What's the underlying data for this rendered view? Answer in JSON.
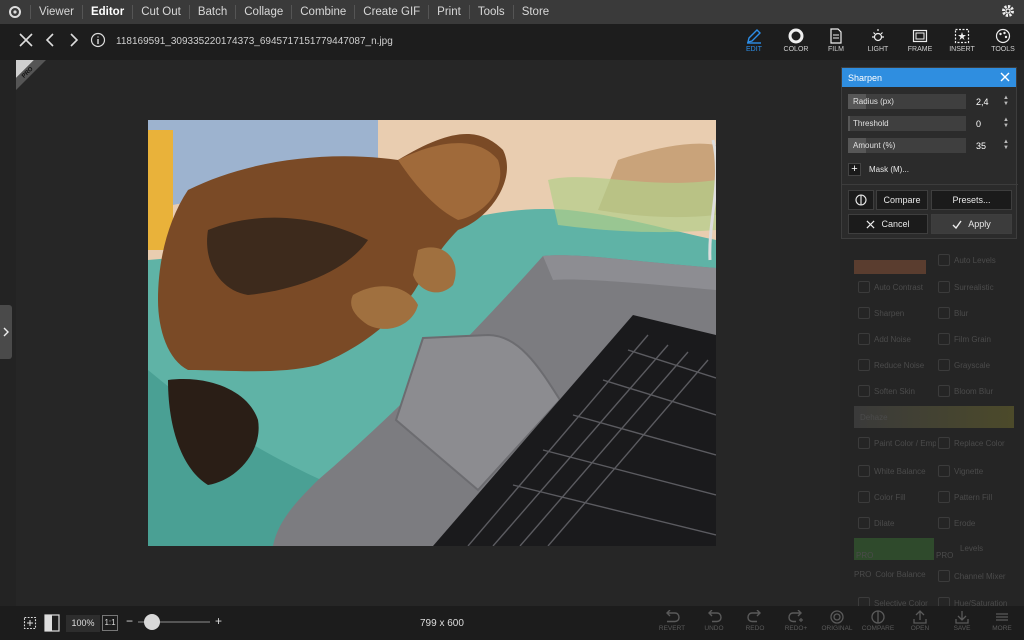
{
  "topnav": {
    "items": [
      {
        "label": "Viewer"
      },
      {
        "label": "Editor"
      },
      {
        "label": "Cut Out"
      },
      {
        "label": "Batch"
      },
      {
        "label": "Collage"
      },
      {
        "label": "Combine"
      },
      {
        "label": "Create GIF"
      },
      {
        "label": "Print"
      },
      {
        "label": "Tools"
      },
      {
        "label": "Store"
      }
    ],
    "active": "Editor"
  },
  "toolbar": {
    "filename": "118169591_309335220174373_6945717151779447087_n.jpg",
    "tools": [
      {
        "label": "EDIT",
        "icon": "edit-icon"
      },
      {
        "label": "COLOR",
        "icon": "color-icon"
      },
      {
        "label": "FILM",
        "icon": "film-icon"
      },
      {
        "label": "LIGHT",
        "icon": "light-icon"
      },
      {
        "label": "FRAME",
        "icon": "frame-icon"
      },
      {
        "label": "INSERT",
        "icon": "insert-icon"
      },
      {
        "label": "TOOLS",
        "icon": "tools-icon"
      }
    ],
    "accent": "#2c8ee8"
  },
  "canvas": {
    "pro_badge": "PRO"
  },
  "sharpen_dialog": {
    "title": "Sharpen",
    "sliders": [
      {
        "label": "Radius (px)",
        "value": "2,4",
        "fill": 0.15
      },
      {
        "label": "Threshold",
        "value": "0",
        "fill": 0.02
      },
      {
        "label": "Amount (%)",
        "value": "35",
        "fill": 0.15
      }
    ],
    "mask_label": "Mask (M)...",
    "compare_label": "Compare",
    "presets_label": "Presets...",
    "cancel_label": "Cancel",
    "apply_label": "Apply",
    "header_color": "#2f8ee0"
  },
  "right_panel": {
    "items": [
      {
        "label": "Auto Levels"
      },
      {
        "label": "Auto Contrast"
      },
      {
        "label": "Surrealistic"
      },
      {
        "label": "Sharpen"
      },
      {
        "label": "Blur"
      },
      {
        "label": "Add Noise"
      },
      {
        "label": "Film Grain"
      },
      {
        "label": "Reduce Noise"
      },
      {
        "label": "Grayscale"
      },
      {
        "label": "Soften Skin"
      },
      {
        "label": "Bloom Blur"
      },
      {
        "label": "Dehaze"
      },
      {
        "label": "Paint Color / Emphasize Col..."
      },
      {
        "label": "Replace Color"
      },
      {
        "label": "White Balance"
      },
      {
        "label": "Vignette"
      },
      {
        "label": "Color Fill"
      },
      {
        "label": "Pattern Fill"
      },
      {
        "label": "Dilate"
      },
      {
        "label": "Erode"
      },
      {
        "label": "Levels"
      },
      {
        "label": "Color Balance"
      },
      {
        "label": "Channel Mixer"
      },
      {
        "label": "Selective Color"
      },
      {
        "label": "Hue/Saturation"
      }
    ],
    "pro_badge": "PRO"
  },
  "bottombar": {
    "zoom": "100%",
    "one_to_one": "1:1",
    "minus": "−",
    "plus": "+",
    "zoom_level": 0.2,
    "dimensions": "799 x 600",
    "actions": [
      {
        "label": "REVERT"
      },
      {
        "label": "UNDO"
      },
      {
        "label": "REDO"
      },
      {
        "label": "REDO+"
      },
      {
        "label": "ORIGINAL"
      },
      {
        "label": "COMPARE"
      },
      {
        "label": "OPEN"
      },
      {
        "label": "SAVE"
      },
      {
        "label": "MORE"
      }
    ]
  }
}
